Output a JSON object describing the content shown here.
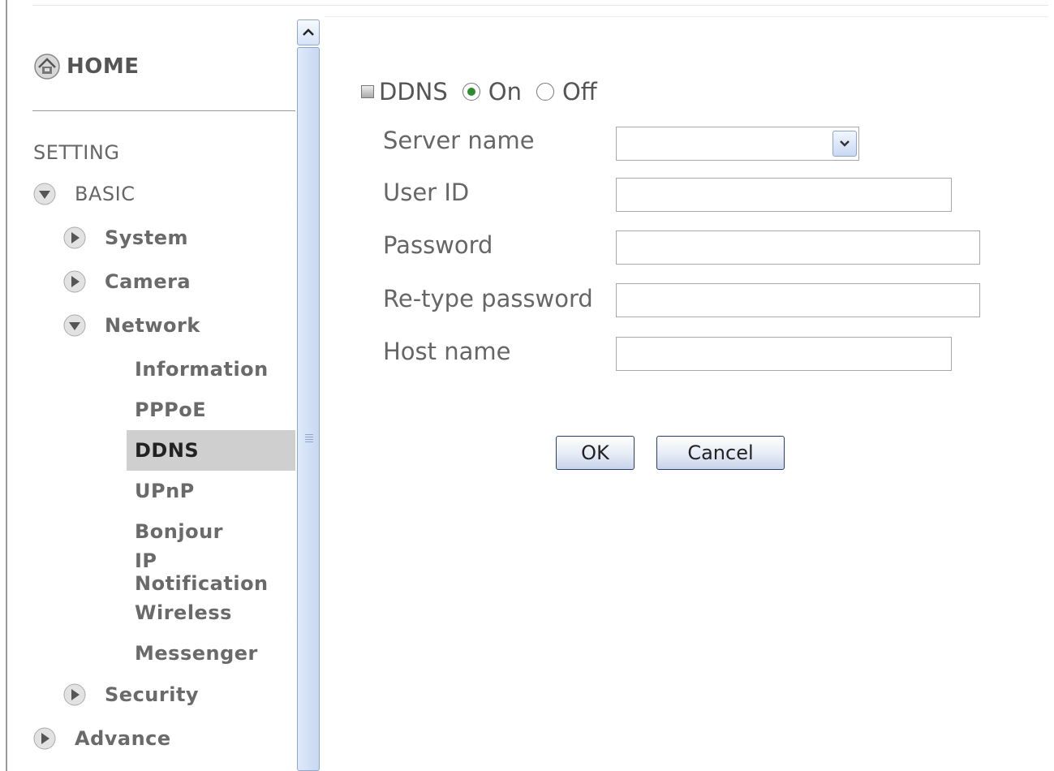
{
  "sidebar": {
    "home_label": "HOME",
    "section_label": "SETTING",
    "basic_label": "BASIC",
    "system_label": "System",
    "camera_label": "Camera",
    "network_label": "Network",
    "network_items": [
      "Information",
      "PPPoE",
      "DDNS",
      "UPnP",
      "Bonjour",
      "IP Notification",
      "Wireless",
      "Messenger"
    ],
    "active_item": "DDNS",
    "security_label": "Security",
    "advance_label": "Advance"
  },
  "form": {
    "ddns_label": "DDNS",
    "on_label": "On",
    "off_label": "Off",
    "ddns_selected": "On",
    "server_name_label": "Server name",
    "server_name_value": "",
    "user_id_label": "User ID",
    "user_id_value": "",
    "password_label": "Password",
    "password_value": "",
    "retype_password_label": "Re-type password",
    "retype_password_value": "",
    "host_name_label": "Host name",
    "host_name_value": "",
    "ok_label": "OK",
    "cancel_label": "Cancel"
  },
  "icons": {
    "home": "home-icon",
    "expanded": "chevron-down-icon",
    "collapsed": "chevron-right-icon",
    "scroll_up": "arrow-up-icon",
    "dropdown": "chevron-down-icon"
  },
  "colors": {
    "active_bg": "#cfcfcf",
    "radio_selected": "#2e8b2e",
    "scrollbar": "#c7d8f2",
    "button_border": "#2b3f6c"
  }
}
